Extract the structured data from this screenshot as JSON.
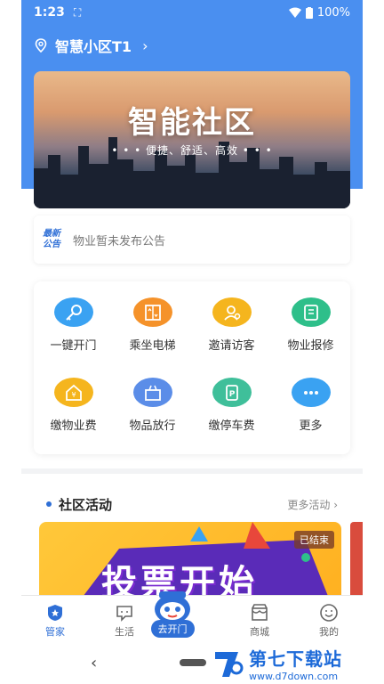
{
  "status_bar": {
    "time": "1:23",
    "battery": "100%"
  },
  "header": {
    "community_name": "智慧小区T1",
    "chevron": "›"
  },
  "banner": {
    "title": "智能社区",
    "subtitle": "• • •  便捷、舒适、高效  • • •"
  },
  "notice": {
    "tag_line1": "最新",
    "tag_line2": "公告",
    "text": "物业暂未发布公告"
  },
  "grid": {
    "items": [
      {
        "label": "一键开门",
        "icon": "key-icon",
        "color": "#3aa2f2"
      },
      {
        "label": "乘坐电梯",
        "icon": "elevator-icon",
        "color": "#f5922a"
      },
      {
        "label": "邀请访客",
        "icon": "visitor-icon",
        "color": "#f5b51e"
      },
      {
        "label": "物业报修",
        "icon": "repair-icon",
        "color": "#2ebf8a"
      },
      {
        "label": "缴物业费",
        "icon": "property-fee-icon",
        "color": "#f5b51e"
      },
      {
        "label": "物品放行",
        "icon": "item-release-icon",
        "color": "#5b8de8"
      },
      {
        "label": "缴停车费",
        "icon": "parking-icon",
        "color": "#3fbf9a"
      },
      {
        "label": "更多",
        "icon": "more-icon",
        "color": "#3aa2f2"
      }
    ]
  },
  "activity": {
    "title": "社区活动",
    "more": "更多活动 ›",
    "ended_badge": "已结束",
    "poster_text": "投票开始"
  },
  "tabbar": {
    "items": [
      {
        "label": "管家",
        "icon": "butler-icon"
      },
      {
        "label": "生活",
        "icon": "life-icon"
      },
      {
        "label": "去开门",
        "icon": "open-door-mascot-icon"
      },
      {
        "label": "商城",
        "icon": "mall-icon"
      },
      {
        "label": "我的",
        "icon": "profile-icon"
      }
    ]
  },
  "navbar": {
    "back": "‹"
  },
  "watermark": {
    "title": "第七下载站",
    "url": "www.d7down.com"
  },
  "colors": {
    "primary": "#4a8ff0",
    "accent": "#2f6fd6"
  }
}
